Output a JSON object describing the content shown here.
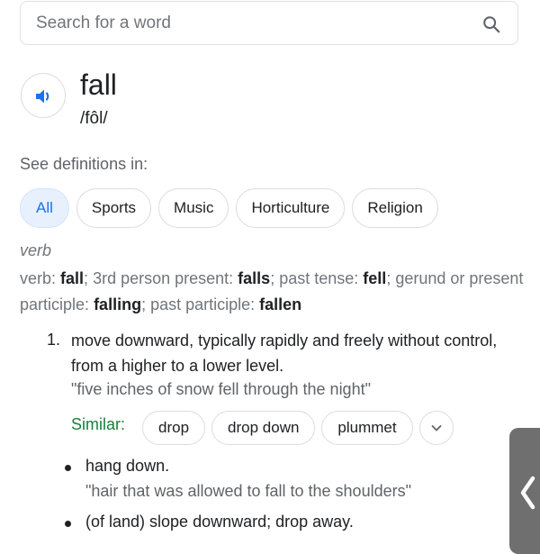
{
  "search": {
    "placeholder": "Search for a word"
  },
  "entry": {
    "word": "fall",
    "pronunciation": "/fôl/"
  },
  "see_definitions": {
    "label": "See definitions in:",
    "chips": [
      "All",
      "Sports",
      "Music",
      "Horticulture",
      "Religion"
    ],
    "selected": "All"
  },
  "part_of_speech": "verb",
  "forms": {
    "verb_label": "verb",
    "verb": "fall",
    "third_person_label": "3rd person present",
    "third_person": "falls",
    "past_tense_label": "past tense",
    "past_tense": "fell",
    "gerund_label": "gerund or present participle",
    "gerund": "falling",
    "past_participle_label": "past participle",
    "past_participle": "fallen"
  },
  "definitions": [
    {
      "number": "1.",
      "text": "move downward, typically rapidly and freely without control, from a higher to a lower level.",
      "example": "\"five inches of snow fell through the night\"",
      "similar_label": "Similar:",
      "similar": [
        "drop",
        "drop down",
        "plummet"
      ],
      "sub_senses": [
        {
          "text": "hang down.",
          "example": "\"hair that was allowed to fall to the shoulders\""
        },
        {
          "text": "(of land) slope downward; drop away."
        }
      ]
    }
  ],
  "colors": {
    "accent": "#1a73e8",
    "similar_green": "#188038",
    "muted": "#70757a"
  },
  "icons": {
    "search": "search-icon",
    "speaker": "speaker-icon",
    "expand": "chevron-down-icon",
    "side_tab": "chevron-left-icon"
  }
}
